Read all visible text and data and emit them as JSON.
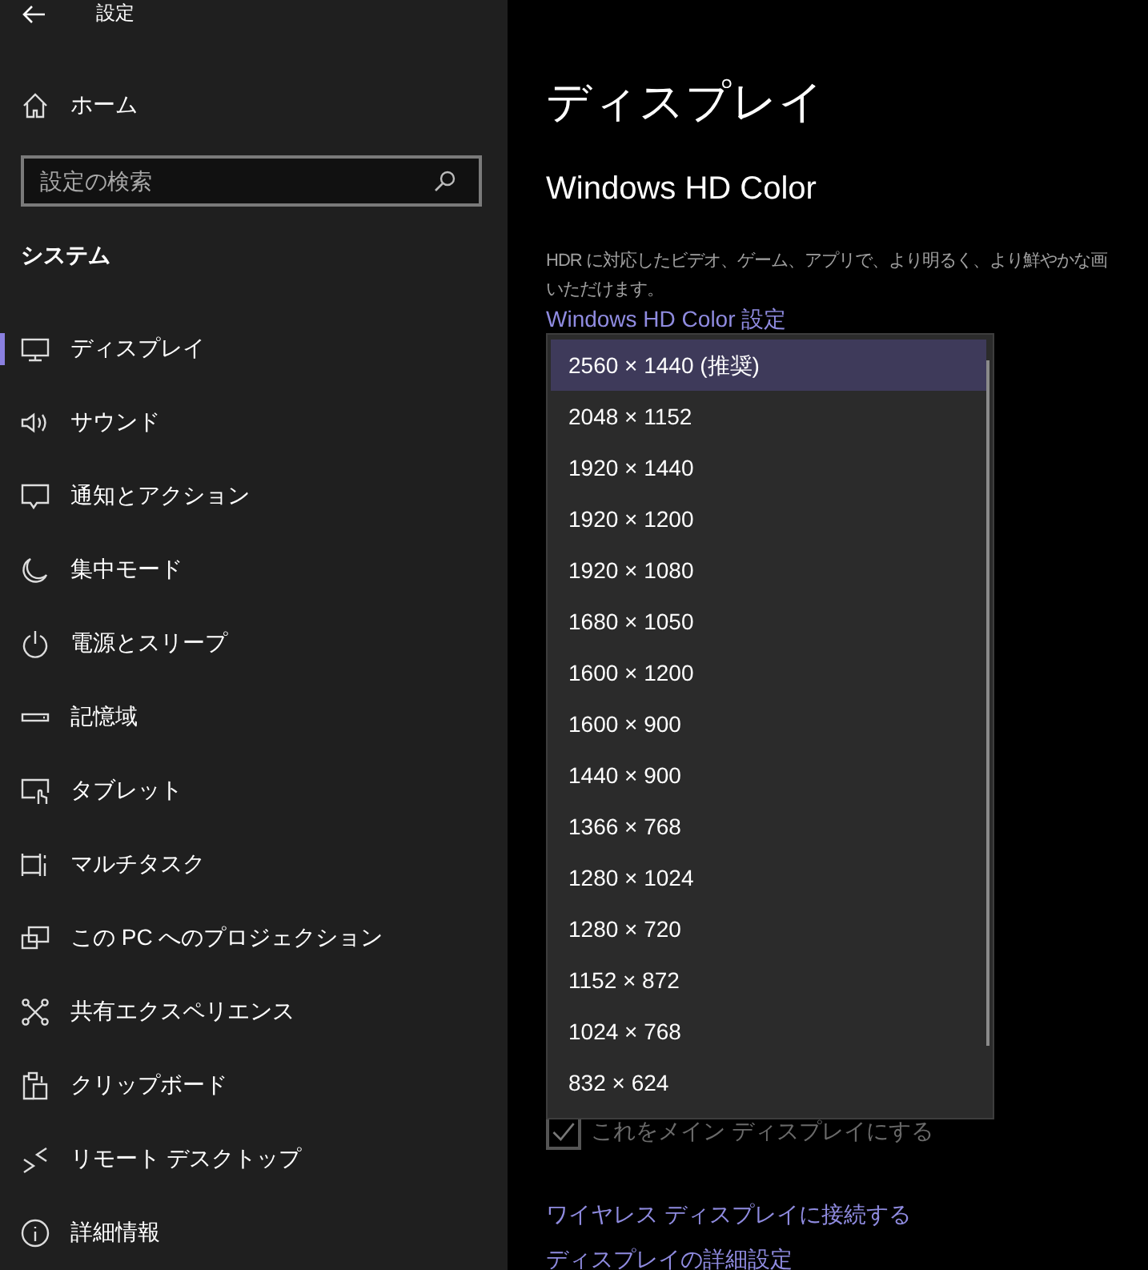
{
  "window": {
    "title": "設定"
  },
  "sidebar": {
    "home": "ホーム",
    "search": {
      "placeholder": "設定の検索"
    },
    "section": "システム",
    "items": [
      {
        "label": "ディスプレイ",
        "selected": true
      },
      {
        "label": "サウンド",
        "selected": false
      },
      {
        "label": "通知とアクション",
        "selected": false
      },
      {
        "label": "集中モード",
        "selected": false
      },
      {
        "label": "電源とスリープ",
        "selected": false
      },
      {
        "label": "記憶域",
        "selected": false
      },
      {
        "label": "タブレット",
        "selected": false
      },
      {
        "label": "マルチタスク",
        "selected": false
      },
      {
        "label": "この PC へのプロジェクション",
        "selected": false
      },
      {
        "label": "共有エクスペリエンス",
        "selected": false
      },
      {
        "label": "クリップボード",
        "selected": false
      },
      {
        "label": "リモート デスクトップ",
        "selected": false
      },
      {
        "label": "詳細情報",
        "selected": false
      }
    ]
  },
  "main": {
    "title": "ディスプレイ",
    "section": "Windows HD Color",
    "description": [
      "HDR に対応したビデオ、ゲーム、アプリで、より明るく、より鮮やかな画",
      "いただけます。"
    ],
    "hd_link": "Windows HD Color 設定",
    "main_display": {
      "label": "これをメイン ディスプレイにする",
      "checked": true,
      "disabled": true
    },
    "links": [
      "ワイヤレス ディスプレイに接続する",
      "ディスプレイの詳細設定"
    ]
  },
  "resolution_dropdown": {
    "options": [
      {
        "label": "2560 × 1440 (推奨)",
        "selected": true
      },
      {
        "label": "2048 × 1152",
        "selected": false
      },
      {
        "label": "1920 × 1440",
        "selected": false
      },
      {
        "label": "1920 × 1200",
        "selected": false
      },
      {
        "label": "1920 × 1080",
        "selected": false
      },
      {
        "label": "1680 × 1050",
        "selected": false
      },
      {
        "label": "1600 × 1200",
        "selected": false
      },
      {
        "label": "1600 × 900",
        "selected": false
      },
      {
        "label": "1440 × 900",
        "selected": false
      },
      {
        "label": "1366 × 768",
        "selected": false
      },
      {
        "label": "1280 × 1024",
        "selected": false
      },
      {
        "label": "1280 × 720",
        "selected": false
      },
      {
        "label": "1152 × 872",
        "selected": false
      },
      {
        "label": "1024 × 768",
        "selected": false
      },
      {
        "label": "832 × 624",
        "selected": false
      }
    ]
  }
}
